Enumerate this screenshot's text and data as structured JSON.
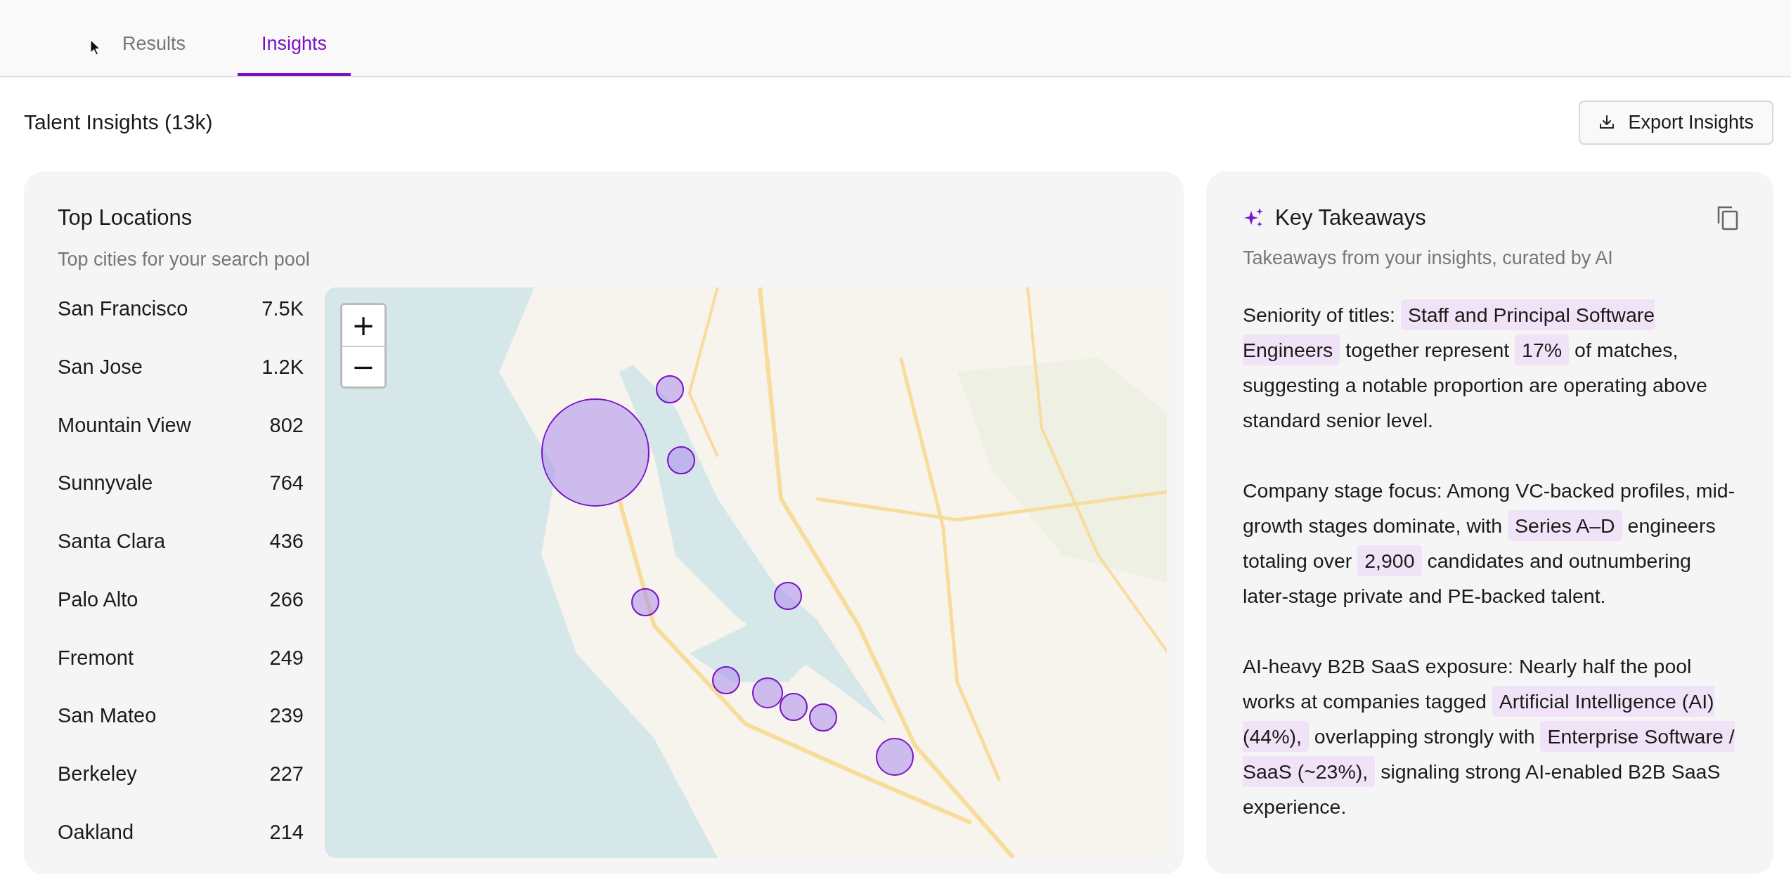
{
  "tabs": [
    {
      "label": "Results",
      "selected": false
    },
    {
      "label": "Insights",
      "selected": true
    }
  ],
  "header": {
    "title": "Talent Insights (13k)",
    "export_button": "Export Insights"
  },
  "top_locations": {
    "title": "Top Locations",
    "subtitle": "Top cities for your search pool",
    "rows": [
      {
        "city": "San Francisco",
        "count": "7.5K"
      },
      {
        "city": "San Jose",
        "count": "1.2K"
      },
      {
        "city": "Mountain View",
        "count": "802"
      },
      {
        "city": "Sunnyvale",
        "count": "764"
      },
      {
        "city": "Santa Clara",
        "count": "436"
      },
      {
        "city": "Palo Alto",
        "count": "266"
      },
      {
        "city": "Fremont",
        "count": "249"
      },
      {
        "city": "San Mateo",
        "count": "239"
      },
      {
        "city": "Berkeley",
        "count": "227"
      },
      {
        "city": "Oakland",
        "count": "214"
      }
    ],
    "map": {
      "kind": "picture",
      "zoom_in": "+",
      "zoom_out": "−"
    }
  },
  "key_takeaways": {
    "title": "Key Takeaways",
    "subtitle": "Takeaways from your insights, curated by AI",
    "paragraphs": [
      [
        {
          "text": "Seniority of titles: ",
          "highlight": false
        },
        {
          "text": "Staff and Principal Software Engineers",
          "highlight": true
        },
        {
          "text": " together represent ",
          "highlight": false
        },
        {
          "text": "17%",
          "highlight": true
        },
        {
          "text": " of matches, suggesting a notable proportion are operating above standard senior level.",
          "highlight": false
        }
      ],
      [
        {
          "text": "Company stage focus: Among VC-backed profiles, mid-growth stages dominate, with ",
          "highlight": false
        },
        {
          "text": "Series A–D",
          "highlight": true
        },
        {
          "text": " engineers totaling over ",
          "highlight": false
        },
        {
          "text": "2,900",
          "highlight": true
        },
        {
          "text": " candidates and outnumbering later-stage private and PE-backed talent.",
          "highlight": false
        }
      ],
      [
        {
          "text": "AI-heavy B2B SaaS exposure: Nearly half the pool works at companies tagged ",
          "highlight": false
        },
        {
          "text": "Artificial Intelligence (AI) (44%),",
          "highlight": true
        },
        {
          "text": " overlapping strongly with ",
          "highlight": false
        },
        {
          "text": "Enterprise Software / SaaS (~23%),",
          "highlight": true
        },
        {
          "text": " signaling strong AI-enabled B2B SaaS experience.",
          "highlight": false
        }
      ]
    ]
  }
}
